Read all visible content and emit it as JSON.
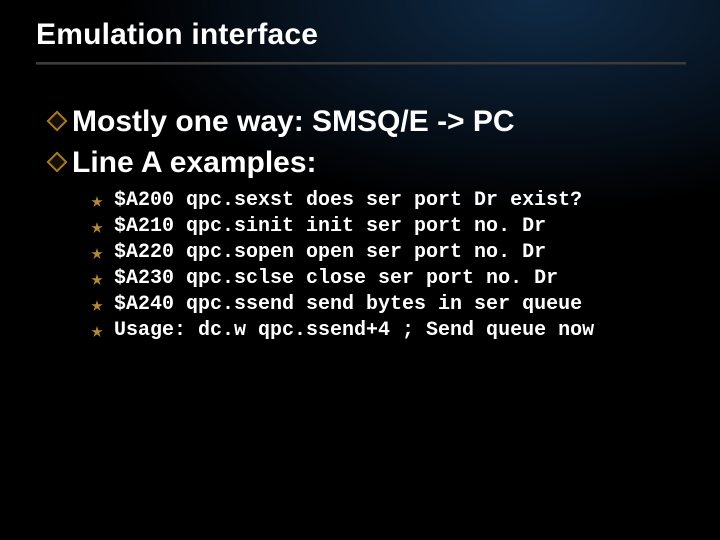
{
  "slide": {
    "title": "Emulation interface",
    "bullets_l1": [
      "Mostly one way: SMSQ/E -> PC",
      "Line A examples:"
    ],
    "bullets_l2": [
      "$A200 qpc.sexst does ser port Dr exist?",
      "$A210 qpc.sinit init ser port no. Dr",
      "$A220 qpc.sopen open ser port no. Dr",
      "$A230 qpc.sclse close ser port no. Dr",
      "$A240 qpc.ssend send bytes in ser queue",
      "Usage: dc.w qpc.ssend+4 ; Send queue now"
    ],
    "colors": {
      "diamond_outline": "#c08a1f",
      "star_fill": "#b48a2e"
    }
  }
}
